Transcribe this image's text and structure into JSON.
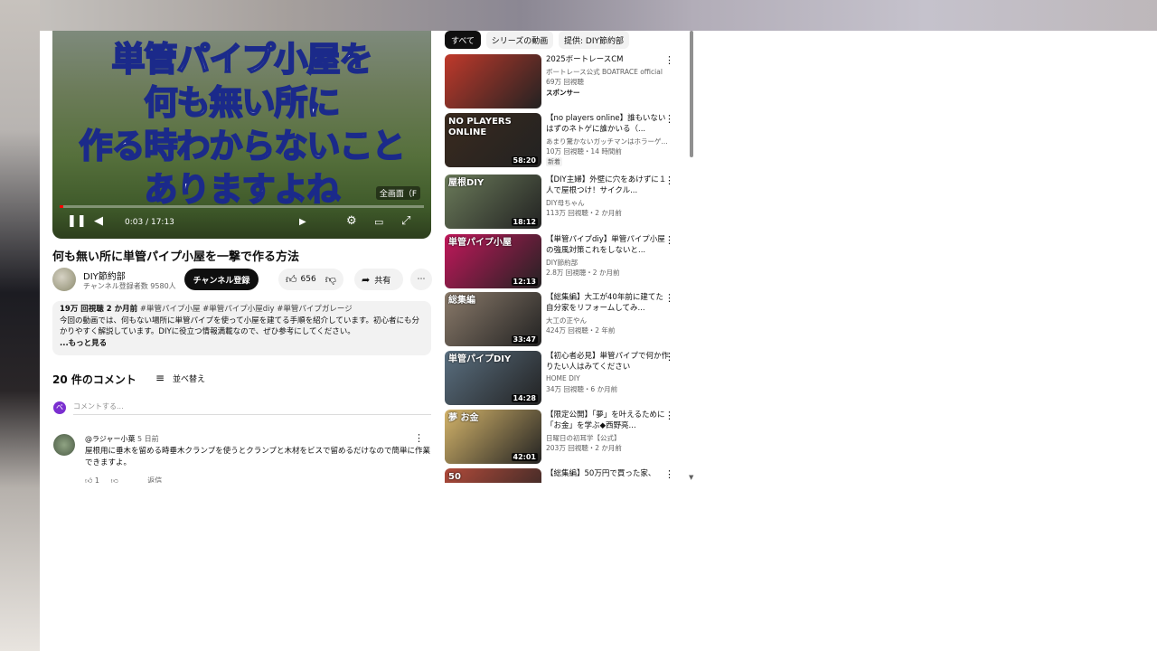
{
  "video": {
    "overlay_lines": [
      "単管パイプ小屋を",
      "何も無い所に",
      "作る時わからないこと",
      "ありますよね"
    ],
    "fullscreen_tag": "全画面（F",
    "time": "0:03 / 17:13",
    "progress": 0.003,
    "title": "何も無い所に単管パイプ小屋を一撃で作る方法"
  },
  "channel": {
    "name": "DIY節約部",
    "subs": "チャンネル登録者数 9580人",
    "subscribe_label": "チャンネル登録",
    "like_count": "656",
    "share_label": "共有"
  },
  "description": {
    "meta": "19万 回視聴  2 か月前",
    "tags": "#単管パイプ小屋 #単管パイプ小屋diy #単管パイプガレージ",
    "text": "今回の動画では、何もない場所に単管パイプを使って小屋を建てる手順を紹介しています。初心者にも分かりやすく解説しています。DIYに役立つ情報満載なので、ぜひ参考にしてください。",
    "more": "...もっと見る"
  },
  "comments": {
    "header": "20 件のコメント",
    "sort_label": "並べ替え",
    "input_placeholder": "コメントする...",
    "input_avatar": "ベ",
    "first": {
      "user": "@ラジャー小葉",
      "ago": "5 日前",
      "text": "屋根用に垂木を留める時垂木クランプを使うとクランプと木材をビスで留めるだけなので簡単に作業できますよ。",
      "likes": "1",
      "reply_label": "返信"
    }
  },
  "chips": [
    "すべて",
    "シリーズの動画",
    "提供: DIY節約部"
  ],
  "recommendations": [
    {
      "title": "2025ボートレースCM",
      "channel": "ボートレース公式 BOATRACE official",
      "meta": "69万 回視聴",
      "badge": "スポンサー",
      "duration": "",
      "thumb_text": "",
      "thumb_color": "#c0392b"
    },
    {
      "title": "【no players online】誰もいないはずのネトゲに誰かいる（...",
      "channel": "あまり驚かないガッチマンはホラーゲ...",
      "meta": "10万 回視聴・14 時間前",
      "badge": "新着",
      "duration": "58:20",
      "thumb_text": "NO PLAYERS ONLINE",
      "thumb_color": "#3a2a1e"
    },
    {
      "title": "【DIY主婦】外壁に穴をあけずに１人で屋根つけ！サイクル...",
      "channel": "DIY母ちゃん",
      "meta": "113万 回視聴・2 か月前",
      "badge": "",
      "duration": "18:12",
      "thumb_text": "屋根DIY",
      "thumb_color": "#6b7b5a"
    },
    {
      "title": "【単管パイプdiy】単管パイプ小屋の強風対策これをしないと...",
      "channel": "DIY節約部",
      "meta": "2.8万 回視聴・2 か月前",
      "badge": "",
      "duration": "12:13",
      "thumb_text": "単管パイプ小屋",
      "thumb_color": "#c2185b"
    },
    {
      "title": "【総集編】大工が40年前に建てた自分家をリフォームしてみ...",
      "channel": "大工の正やん",
      "meta": "424万 回視聴・2 年前",
      "badge": "",
      "duration": "33:47",
      "thumb_text": "総集編",
      "thumb_color": "#8a7a6a"
    },
    {
      "title": "【初心者必見】単管パイプで何か作りたい人はみてください",
      "channel": "HOME DIY",
      "meta": "34万 回視聴・6 か月前",
      "badge": "",
      "duration": "14:28",
      "thumb_text": "単管パイプDIY",
      "thumb_color": "#5a6f80"
    },
    {
      "title": "【限定公開】「夢」を叶えるために「お金」を学ぶ◆西野亮...",
      "channel": "日曜日の初耳学【公式】",
      "meta": "203万 回視聴・2 か月前",
      "badge": "",
      "duration": "42:01",
      "thumb_text": "夢 お金",
      "thumb_color": "#d4b46a"
    },
    {
      "title": "【総集編】50万円で買った家、",
      "channel": "",
      "meta": "",
      "badge": "",
      "duration": "",
      "thumb_text": "50",
      "thumb_color": "#b04a3a"
    }
  ]
}
